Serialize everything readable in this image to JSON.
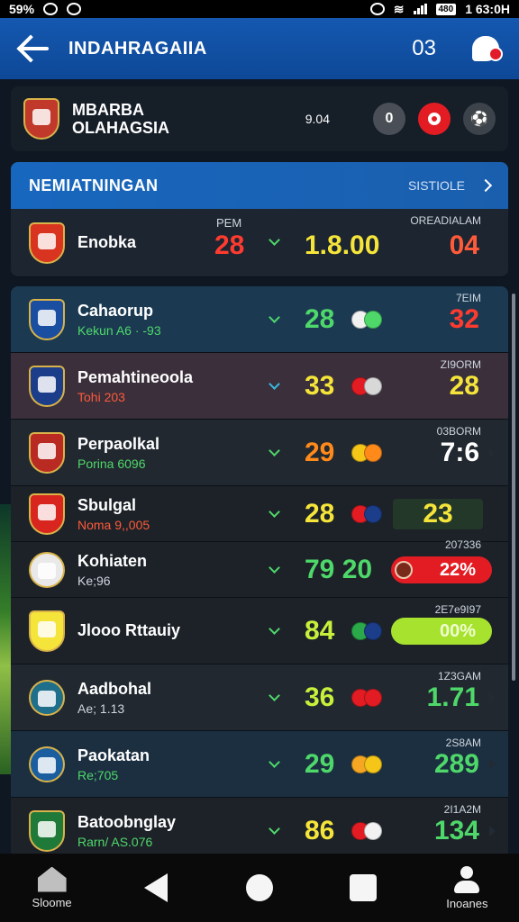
{
  "status_bar": {
    "left_text": "59%",
    "battery": "480",
    "time": "1 63:0H"
  },
  "app_bar": {
    "title": "INDAHRAGAIIA",
    "code": "03"
  },
  "match": {
    "team_line1": "MBARBA",
    "team_line2": "OLAHAGSIA",
    "score": "9.04",
    "badge_first": "0"
  },
  "section": {
    "name": "NEMIATNINGAN",
    "link": "SISTIOLE"
  },
  "featured_row": {
    "name": "Enobka",
    "left_caption": "PEM",
    "right_caption": "OREADIALAM",
    "value1": "28",
    "value2": "1.8.00",
    "value3": "04"
  },
  "rows": [
    {
      "name": "Cahaorup",
      "sub": "Kekun A6 · -93",
      "caption": "7EIM",
      "value": "28",
      "right": "32"
    },
    {
      "name": "Pemahtineoola",
      "sub": "Tohi 203",
      "caption": "ZI9ORM",
      "value": "33",
      "right": "28"
    },
    {
      "name": "Perpaolkal",
      "sub": "Porina 6096",
      "caption": "03BORM",
      "value": "29",
      "right": "7:6"
    },
    {
      "name": "Sbulgal",
      "sub": "Noma 9,,005",
      "caption": "",
      "value": "28",
      "right": "23"
    },
    {
      "name": "Kohiaten",
      "sub": "Ke;96",
      "caption": "207336",
      "value": "79 20",
      "right": "22%"
    },
    {
      "name": "Jlooo Rttauiy",
      "sub": "",
      "caption": "2E7e9I97",
      "value": "84",
      "right": "00%"
    },
    {
      "name": "Aadbohal",
      "sub": "Ae; 1.13",
      "caption": "1Z3GAM",
      "value": "36",
      "right": "1.71"
    },
    {
      "name": "Paokatan",
      "sub": "Re;705",
      "caption": "2S8AM",
      "value": "29",
      "right": "289"
    },
    {
      "name": "Batoobnglay",
      "sub": "Rarn/ AS.076",
      "caption": "2I1A2M",
      "value": "86",
      "right": "134"
    }
  ],
  "nav": {
    "home_label": "Sloome",
    "profile_label": "Inoanes"
  },
  "colors": {
    "brand": "#1458b0",
    "accent_red": "#e31c23",
    "accent_green": "#4fd86a",
    "accent_yellow": "#f5e53a"
  }
}
